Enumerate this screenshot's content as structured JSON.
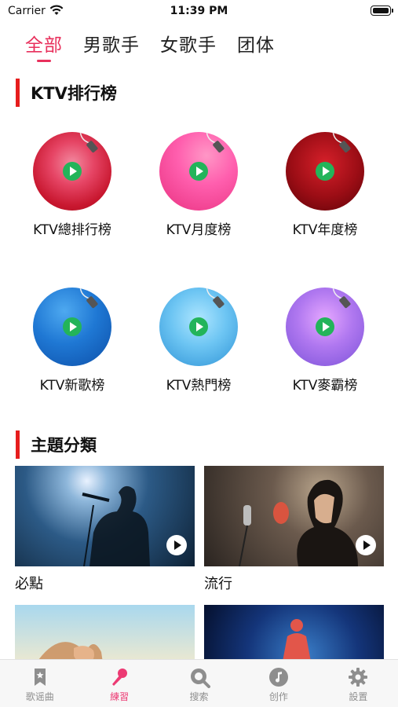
{
  "status_bar": {
    "carrier": "Carrier",
    "time": "11:39 PM"
  },
  "tabs": [
    {
      "label": "全部",
      "active": true
    },
    {
      "label": "男歌手",
      "active": false
    },
    {
      "label": "女歌手",
      "active": false
    },
    {
      "label": "团体",
      "active": false
    }
  ],
  "ktv_section": {
    "title": "KTV排行榜",
    "items": [
      {
        "label": "KTV總排行榜",
        "icon": "play-icon"
      },
      {
        "label": "KTV月度榜",
        "icon": "play-icon"
      },
      {
        "label": "KTV年度榜",
        "icon": "play-icon"
      },
      {
        "label": "KTV新歌榜",
        "icon": "play-icon"
      },
      {
        "label": "KTV熱門榜",
        "icon": "play-icon"
      },
      {
        "label": "KTV麥霸榜",
        "icon": "play-icon"
      }
    ]
  },
  "theme_section": {
    "title": "主題分類",
    "items": [
      {
        "label": "必點"
      },
      {
        "label": "流行"
      },
      {
        "label": ""
      },
      {
        "label": ""
      }
    ]
  },
  "tabbar": {
    "items": [
      {
        "label": "歌谣曲",
        "icon": "bookmark-star-icon",
        "active": false
      },
      {
        "label": "練習",
        "icon": "microphone-icon",
        "active": true
      },
      {
        "label": "搜索",
        "icon": "search-icon",
        "active": false
      },
      {
        "label": "创作",
        "icon": "music-note-icon",
        "active": false
      },
      {
        "label": "設置",
        "icon": "gear-icon",
        "active": false
      }
    ]
  },
  "colors": {
    "accent": "#e8305c",
    "section_bar": "#e61d1d",
    "play_green": "#23b45a",
    "tab_active": "#ec3a73",
    "tab_inactive": "#8e8e8e"
  }
}
